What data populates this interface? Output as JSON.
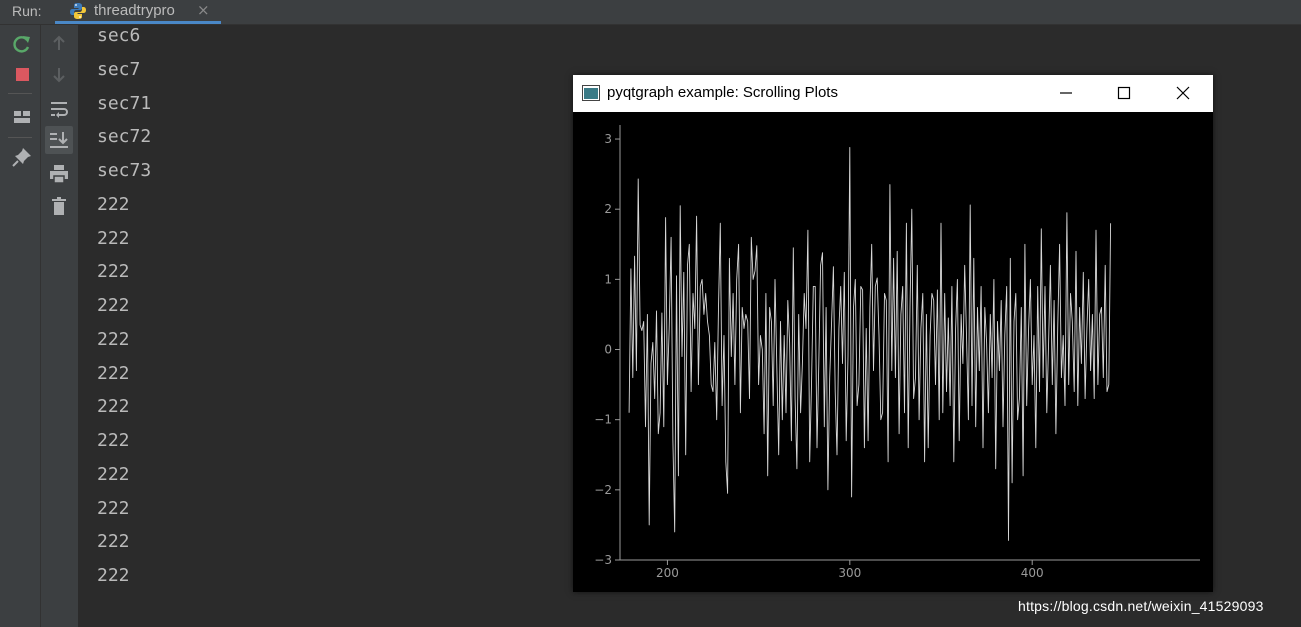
{
  "run_panel": {
    "label": "Run:",
    "tab": {
      "title": "threadtrypro",
      "close": "×"
    }
  },
  "toolbar_left": [
    "rerun-icon",
    "stop-icon",
    "layout-icon",
    "pin-icon"
  ],
  "toolbar_right": [
    "up-arrow-icon",
    "down-arrow-icon",
    "soft-wrap-icon",
    "scroll-to-end-icon",
    "print-icon",
    "trash-icon"
  ],
  "console": {
    "lines": [
      "sec6",
      "sec7",
      "sec71",
      "sec72",
      "sec73",
      "222",
      "222",
      "222",
      "222",
      "222",
      "222",
      "222",
      "222",
      "222",
      "222",
      "222",
      "222"
    ]
  },
  "plot_window": {
    "title": "pyqtgraph example: Scrolling Plots",
    "controls": [
      "minimize-icon",
      "maximize-icon",
      "close-icon"
    ]
  },
  "colors": {
    "ide_bg": "#2b2b2b",
    "toolbar_bg": "#3c3f41",
    "console_text": "#bababa",
    "rerun": "#59a869",
    "stop": "#db5860",
    "tab_underline": "#4a88c7",
    "plot_bg": "#000000",
    "plot_line": "#d8d8d8"
  },
  "chart_data": {
    "type": "line",
    "title": "",
    "xlabel": "",
    "ylabel": "",
    "xlim": [
      174,
      492
    ],
    "ylim": [
      -3,
      3.2
    ],
    "x_ticks": [
      200,
      300,
      400
    ],
    "y_ticks": [
      3,
      2,
      1,
      0,
      -1,
      -2,
      -3
    ],
    "grid": false,
    "x_start": 179,
    "x_step": 1,
    "values": [
      -0.9,
      1.15,
      -0.4,
      1.33,
      -0.3,
      2.43,
      0.35,
      0.27,
      0.4,
      -1.1,
      0.5,
      -2.5,
      -0.2,
      0.1,
      -0.7,
      0.55,
      -1.2,
      -0.9,
      0.52,
      -1.1,
      1.88,
      -0.5,
      0.3,
      1.6,
      -1.3,
      -2.6,
      1.05,
      -1.8,
      2.05,
      -0.1,
      1.1,
      -1.5,
      1.2,
      1.5,
      -0.6,
      0.8,
      0.3,
      1.9,
      -0.5,
      0.9,
      1.0,
      0.5,
      0.8,
      0.4,
      0.2,
      -0.5,
      -0.6,
      0.1,
      -1.0,
      0.6,
      1.8,
      -0.8,
      0.2,
      -1.6,
      -2.05,
      1.3,
      -0.1,
      0.8,
      -0.5,
      1.0,
      1.5,
      -0.9,
      0.6,
      0.3,
      0.5,
      0.4,
      -0.7,
      1.6,
      1.0,
      1.12,
      1.48,
      -0.5,
      0.2,
      0.0,
      -1.2,
      0.8,
      -1.8,
      0.6,
      0.4,
      -0.8,
      1.0,
      -0.3,
      -1.5,
      0.4,
      -1.0,
      0.2,
      -0.9,
      0.7,
      0.1,
      -1.3,
      1.45,
      -0.7,
      -1.7,
      0.5,
      -0.9,
      -0.2,
      0.8,
      0.3,
      1.7,
      -1.6,
      -0.5,
      0.9,
      0.9,
      -1.4,
      -0.2,
      1.2,
      1.38,
      -1.1,
      0.6,
      -2.0,
      -0.4,
      0.4,
      1.18,
      -0.6,
      -1.5,
      0.3,
      0.9,
      -0.2,
      1.1,
      -1.3,
      -0.1,
      2.88,
      -2.1,
      0.6,
      1.0,
      -0.8,
      -0.5,
      0.9,
      0.85,
      -1.4,
      0.3,
      -1.3,
      0.6,
      1.5,
      -0.3,
      0.9,
      1.02,
      0.2,
      -1.0,
      -0.9,
      0.8,
      0.7,
      -1.6,
      2.35,
      -0.3,
      1.3,
      -0.4,
      1.4,
      -1.2,
      0.5,
      0.9,
      -0.9,
      1.8,
      -1.4,
      0.6,
      2.0,
      -0.7,
      -0.4,
      1.2,
      -1.0,
      0.3,
      0.8,
      -1.6,
      0.5,
      -1.4,
      0.2,
      0.8,
      0.7,
      -0.5,
      0.85,
      -1.0,
      1.8,
      -0.9,
      0.8,
      -0.6,
      0.45,
      -0.8,
      0.9,
      -1.6,
      0.3,
      1.0,
      -1.3,
      0.5,
      -0.2,
      1.2,
      0.2,
      -1.0,
      2.06,
      -0.8,
      1.3,
      -1.1,
      0.6,
      -0.3,
      0.9,
      -1.4,
      0.6,
      0.1,
      -0.9,
      0.5,
      -0.4,
      1.0,
      -1.7,
      0.4,
      -0.3,
      0.7,
      -1.1,
      0.2,
      0.9,
      -2.72,
      1.3,
      -1.9,
      0.4,
      0.8,
      -1.0,
      -0.7,
      0.6,
      -1.8,
      1.5,
      -0.8,
      0.3,
      1.0,
      -0.5,
      0.2,
      -1.4,
      0.9,
      -0.6,
      1.72,
      -0.4,
      0.9,
      -0.9,
      0.1,
      1.2,
      -0.5,
      0.7,
      -1.2,
      0.3,
      1.5,
      -0.4,
      0.2,
      -0.8,
      1.95,
      -0.5,
      0.8,
      0.4,
      -0.6,
      1.4,
      -0.8,
      0.6,
      -0.2,
      1.1,
      -0.7,
      0.3,
      1.0,
      -0.3,
      0.5,
      -0.7,
      1.7,
      -0.5,
      0.5,
      0.6,
      -0.4,
      1.2,
      -0.6,
      -0.5,
      1.8
    ]
  }
}
